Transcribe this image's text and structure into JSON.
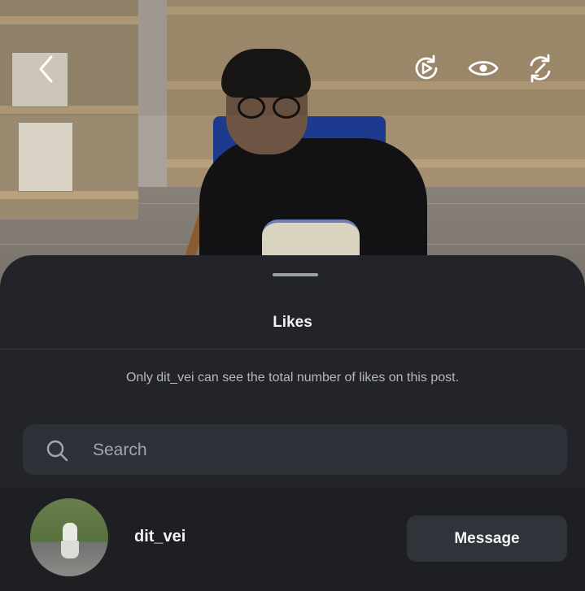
{
  "header": {
    "back_icon": "chevron-left-icon",
    "actions": [
      {
        "name": "replay-icon"
      },
      {
        "name": "eye-icon"
      },
      {
        "name": "repost-icon"
      }
    ]
  },
  "sheet": {
    "title": "Likes",
    "note": "Only dit_vei can see the total number of likes on this post.",
    "search": {
      "placeholder": "Search",
      "value": ""
    },
    "likers": [
      {
        "username": "dit_vei",
        "action_label": "Message"
      }
    ]
  },
  "colors": {
    "sheet_bg": "#222429",
    "search_bg": "#2e3137",
    "button_bg": "#30333a",
    "text_primary": "#f2f3f5",
    "text_secondary": "#b5b8bd"
  }
}
